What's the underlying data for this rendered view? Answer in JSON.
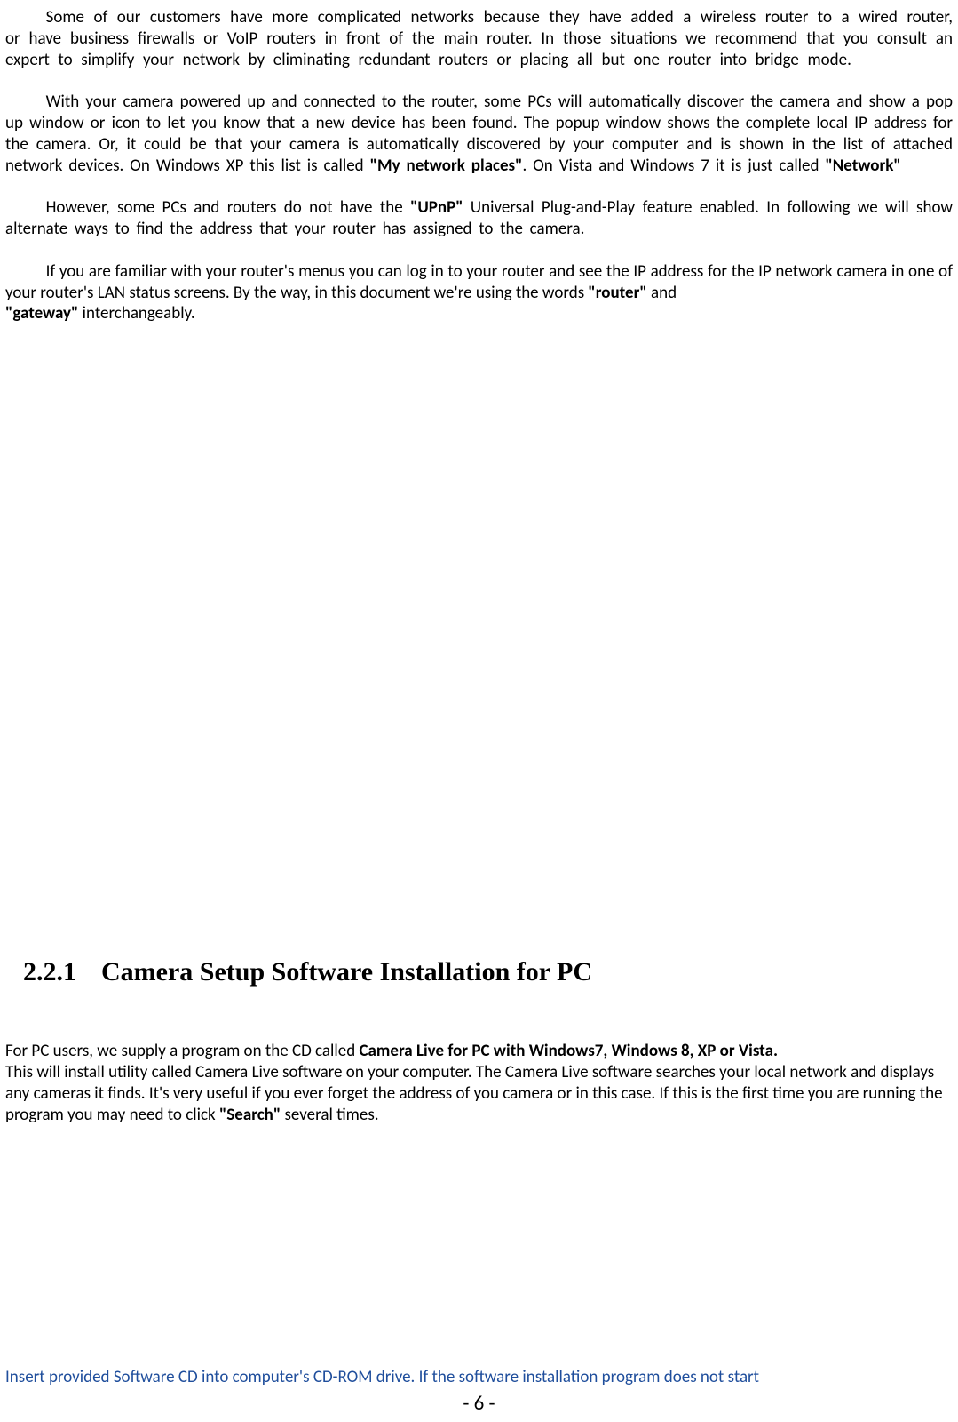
{
  "paragraphs": {
    "p1": {
      "t1": "Some of our customers have more complicated networks because they have added a wireless router to a wired router, or have business firewalls or VoIP routers in front of the main router. In those situations we recommend that you consult an expert to simplify your network by eliminating redundant routers or placing all but one router into bridge mode."
    },
    "p2": {
      "t1": "With your camera powered up and connected to the router, some PCs will automatically discover the camera and show a pop up window or icon to let you know that a new device has been found. The popup window shows the complete local IP address for the camera. Or, it could be that your camera is automatically discovered by your computer and is shown in the list of attached network devices. On Windows XP this list is called ",
      "b1": "\"My network places\"",
      "t2": ". On Vista and Windows 7 it is just called ",
      "b2": "\"Network\""
    },
    "p3": {
      "t1": "However, some PCs and routers do not have the ",
      "b1": "\"UPnP\"",
      "t2": " Universal Plug-and-Play feature enabled. In following we will show alternate ways to find the address that your router has assigned to the camera."
    },
    "p4": {
      "t1": "If you are familiar with your router's menus you can log in to your router and see the IP address for the IP network camera in one of your router's LAN status screens. By the way, in this document we're using the words ",
      "b1": "\"router\"",
      "t2": " and ",
      "b2": "\"gateway\"",
      "t3": " interchangeably."
    }
  },
  "section": {
    "number": "2.2.1",
    "title": "Camera Setup Software Installation for PC"
  },
  "body2": {
    "t1": "For PC users, we supply a program on the CD called ",
    "b1": "Camera Live for PC with Windows7, Windows 8, XP or Vista.",
    "t2": "This will install utility called Camera Live software on your computer. The Camera Live software searches your local network and displays any cameras it finds. It's very useful if you ever forget the address of you camera or in this case. If this is the first time you are running the program you may need to click ",
    "b2": "\"Search\"",
    "t3": " several times."
  },
  "blue_note": "Insert provided Software CD into computer's CD-ROM drive. If the software installation program does not start",
  "page_number": "- 6 -"
}
